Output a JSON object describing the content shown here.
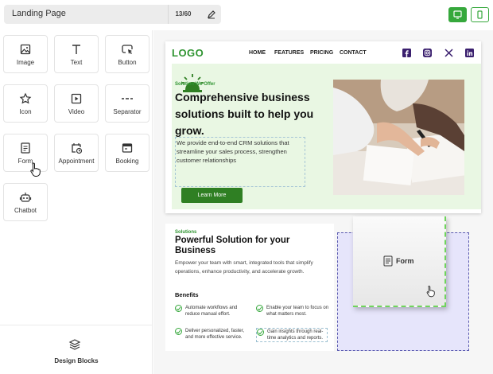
{
  "topbar": {
    "title": "Landing Page",
    "char_count": "13/60",
    "edit_icon": "pencil-icon",
    "desktop_view_icon": "monitor-icon",
    "mobile_view_icon": "phone-icon",
    "accent": "#36a83c"
  },
  "sidebar": {
    "blocks": [
      {
        "label": "Image",
        "icon": "image-icon"
      },
      {
        "label": "Text",
        "icon": "text-icon"
      },
      {
        "label": "Button",
        "icon": "button-cursor-icon"
      },
      {
        "label": "Icon",
        "icon": "star-icon"
      },
      {
        "label": "Video",
        "icon": "play-icon"
      },
      {
        "label": "Separator",
        "icon": "separator-icon"
      },
      {
        "label": "Form",
        "icon": "form-icon"
      },
      {
        "label": "Appointment",
        "icon": "calendar-clock-icon"
      },
      {
        "label": "Booking",
        "icon": "booking-window-icon"
      },
      {
        "label": "Chatbot",
        "icon": "robot-icon"
      }
    ],
    "design_blocks_label": "Design Blocks"
  },
  "hero": {
    "logo": "LOGO",
    "nav": [
      "HOME",
      "FEATURES",
      "PRICING",
      "CONTACT"
    ],
    "social": [
      "facebook-icon",
      "instagram-icon",
      "x-icon",
      "linkedin-icon"
    ],
    "tag": "Solution We Offer",
    "heading": "Comprehensive business solutions built to help you grow.",
    "paragraph": "We provide end-to-end CRM solutions that streamline your sales process, strengthen customer relationships",
    "button": "Learn More",
    "brand_green": "#2f9431"
  },
  "solutions": {
    "tag": "Solutions",
    "heading": "Powerful Solution for your Business",
    "paragraph": "Empower your team with smart, integrated tools that simplify operations, enhance productivity, and accelerate growth.",
    "benefits_title": "Benefits",
    "benefits": [
      "Automate workflows and reduce manual effort.",
      "Enable your team to focus on what matters most.",
      "Deliver personalized, faster, and more effective service.",
      "Gain insights through real-time analytics and reports."
    ]
  },
  "drag_preview": {
    "label": "Form",
    "icon": "form-icon"
  }
}
